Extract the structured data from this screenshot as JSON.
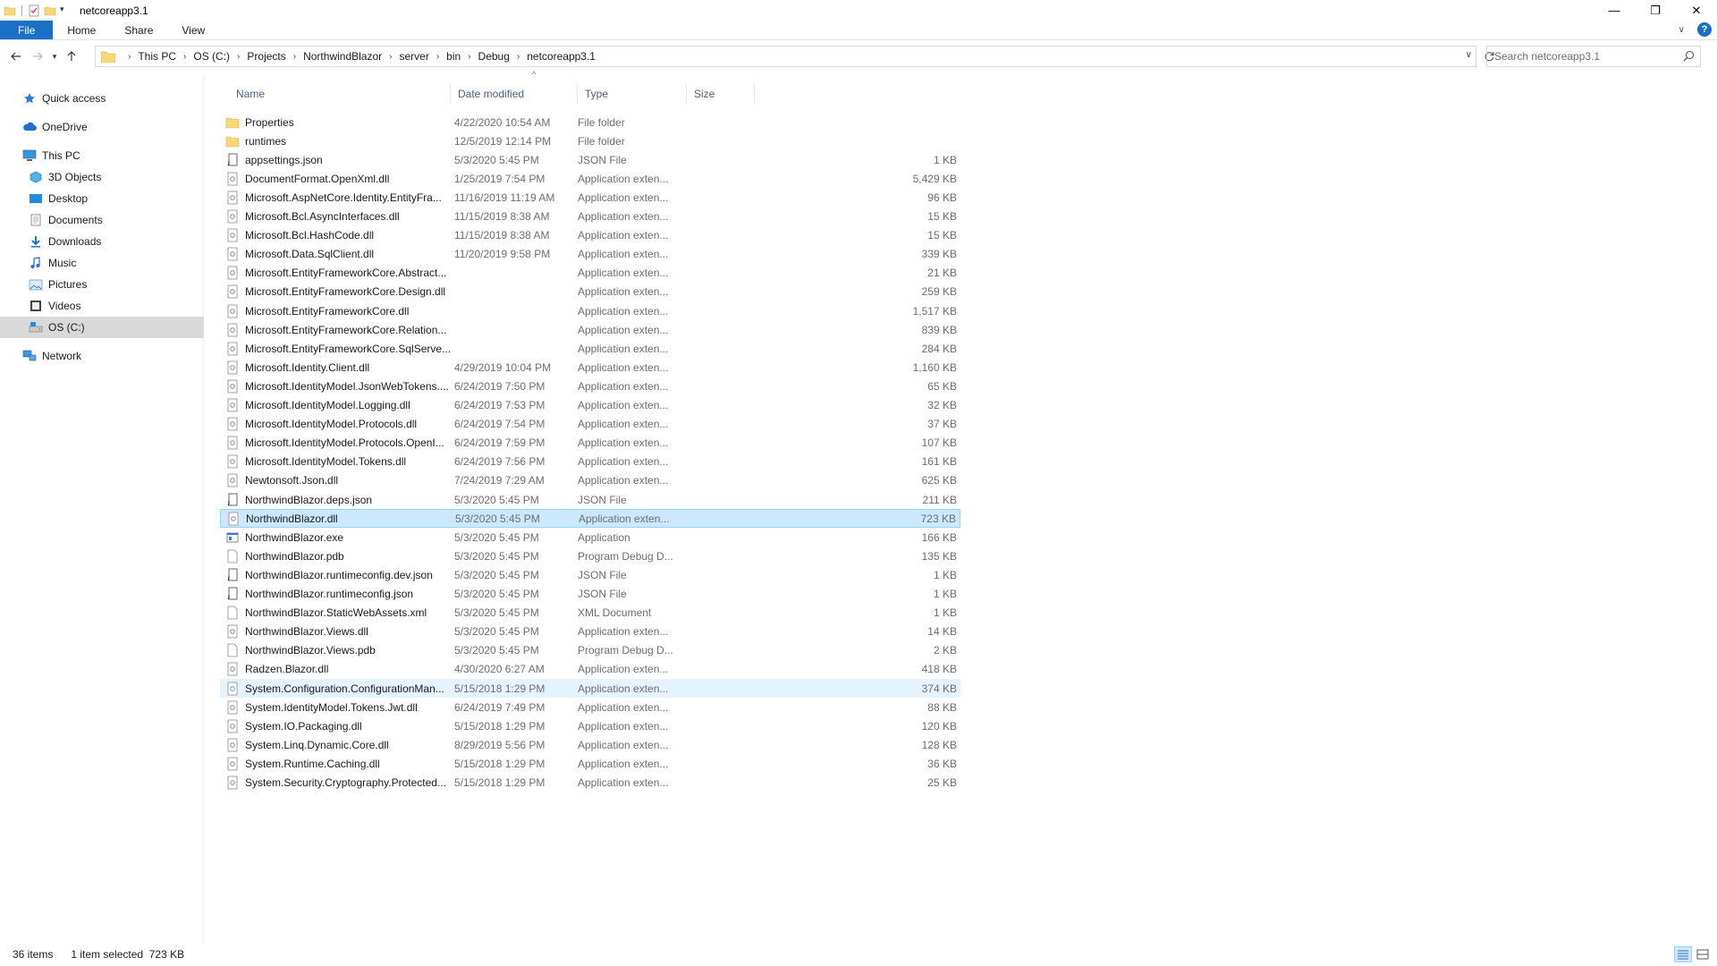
{
  "window": {
    "title": "netcoreapp3.1",
    "controls": {
      "minimize": "—",
      "restore": "❐",
      "close": "✕"
    }
  },
  "ribbon": {
    "tabs": [
      {
        "label": "File"
      },
      {
        "label": "Home"
      },
      {
        "label": "Share"
      },
      {
        "label": "View"
      }
    ]
  },
  "address": {
    "crumbs": [
      "This PC",
      "OS (C:)",
      "Projects",
      "NorthwindBlazor",
      "server",
      "bin",
      "Debug",
      "netcoreapp3.1"
    ]
  },
  "search": {
    "placeholder": "Search netcoreapp3.1"
  },
  "nav": {
    "items": [
      {
        "label": "Quick access",
        "icon": "star-icon"
      },
      {
        "label": "OneDrive",
        "icon": "cloud-icon"
      },
      {
        "label": "This PC",
        "icon": "pc-icon"
      },
      {
        "label": "3D Objects",
        "icon": "cube-icon"
      },
      {
        "label": "Desktop",
        "icon": "desktop-icon"
      },
      {
        "label": "Documents",
        "icon": "documents-icon"
      },
      {
        "label": "Downloads",
        "icon": "download-icon"
      },
      {
        "label": "Music",
        "icon": "music-icon"
      },
      {
        "label": "Pictures",
        "icon": "pictures-icon"
      },
      {
        "label": "Videos",
        "icon": "videos-icon"
      },
      {
        "label": "OS (C:)",
        "icon": "drive-icon"
      },
      {
        "label": "Network",
        "icon": "network-icon"
      }
    ]
  },
  "columns": {
    "name": "Name",
    "date": "Date modified",
    "type": "Type",
    "size": "Size"
  },
  "files": [
    {
      "name": "Properties",
      "date": "4/22/2020 10:54 AM",
      "type": "File folder",
      "size": "",
      "kind": "folder"
    },
    {
      "name": "runtimes",
      "date": "12/5/2019 12:14 PM",
      "type": "File folder",
      "size": "",
      "kind": "folder"
    },
    {
      "name": "appsettings.json",
      "date": "5/3/2020 5:45 PM",
      "type": "JSON File",
      "size": "1 KB",
      "kind": "json"
    },
    {
      "name": "DocumentFormat.OpenXml.dll",
      "date": "1/25/2019 7:54 PM",
      "type": "Application exten...",
      "size": "5,429 KB",
      "kind": "dll"
    },
    {
      "name": "Microsoft.AspNetCore.Identity.EntityFra...",
      "date": "11/16/2019 11:19 AM",
      "type": "Application exten...",
      "size": "96 KB",
      "kind": "dll"
    },
    {
      "name": "Microsoft.Bcl.AsyncInterfaces.dll",
      "date": "11/15/2019 8:38 AM",
      "type": "Application exten...",
      "size": "15 KB",
      "kind": "dll"
    },
    {
      "name": "Microsoft.Bcl.HashCode.dll",
      "date": "11/15/2019 8:38 AM",
      "type": "Application exten...",
      "size": "15 KB",
      "kind": "dll"
    },
    {
      "name": "Microsoft.Data.SqlClient.dll",
      "date": "11/20/2019 9:58 PM",
      "type": "Application exten...",
      "size": "339 KB",
      "kind": "dll"
    },
    {
      "name": "Microsoft.EntityFrameworkCore.Abstract...",
      "date": "",
      "type": "Application exten...",
      "size": "21 KB",
      "kind": "dll"
    },
    {
      "name": "Microsoft.EntityFrameworkCore.Design.dll",
      "date": "",
      "type": "Application exten...",
      "size": "259 KB",
      "kind": "dll"
    },
    {
      "name": "Microsoft.EntityFrameworkCore.dll",
      "date": "",
      "type": "Application exten...",
      "size": "1,517 KB",
      "kind": "dll"
    },
    {
      "name": "Microsoft.EntityFrameworkCore.Relation...",
      "date": "",
      "type": "Application exten...",
      "size": "839 KB",
      "kind": "dll"
    },
    {
      "name": "Microsoft.EntityFrameworkCore.SqlServe...",
      "date": "",
      "type": "Application exten...",
      "size": "284 KB",
      "kind": "dll"
    },
    {
      "name": "Microsoft.Identity.Client.dll",
      "date": "4/29/2019 10:04 PM",
      "type": "Application exten...",
      "size": "1,160 KB",
      "kind": "dll"
    },
    {
      "name": "Microsoft.IdentityModel.JsonWebTokens....",
      "date": "6/24/2019 7:50 PM",
      "type": "Application exten...",
      "size": "65 KB",
      "kind": "dll"
    },
    {
      "name": "Microsoft.IdentityModel.Logging.dll",
      "date": "6/24/2019 7:53 PM",
      "type": "Application exten...",
      "size": "32 KB",
      "kind": "dll"
    },
    {
      "name": "Microsoft.IdentityModel.Protocols.dll",
      "date": "6/24/2019 7:54 PM",
      "type": "Application exten...",
      "size": "37 KB",
      "kind": "dll"
    },
    {
      "name": "Microsoft.IdentityModel.Protocols.OpenI...",
      "date": "6/24/2019 7:59 PM",
      "type": "Application exten...",
      "size": "107 KB",
      "kind": "dll"
    },
    {
      "name": "Microsoft.IdentityModel.Tokens.dll",
      "date": "6/24/2019 7:56 PM",
      "type": "Application exten...",
      "size": "161 KB",
      "kind": "dll"
    },
    {
      "name": "Newtonsoft.Json.dll",
      "date": "7/24/2019 7:29 AM",
      "type": "Application exten...",
      "size": "625 KB",
      "kind": "dll"
    },
    {
      "name": "NorthwindBlazor.deps.json",
      "date": "5/3/2020 5:45 PM",
      "type": "JSON File",
      "size": "211 KB",
      "kind": "json"
    },
    {
      "name": "NorthwindBlazor.dll",
      "date": "5/3/2020 5:45 PM",
      "type": "Application exten...",
      "size": "723 KB",
      "kind": "dll",
      "state": "selected"
    },
    {
      "name": "NorthwindBlazor.exe",
      "date": "5/3/2020 5:45 PM",
      "type": "Application",
      "size": "166 KB",
      "kind": "exe"
    },
    {
      "name": "NorthwindBlazor.pdb",
      "date": "5/3/2020 5:45 PM",
      "type": "Program Debug D...",
      "size": "135 KB",
      "kind": "blank"
    },
    {
      "name": "NorthwindBlazor.runtimeconfig.dev.json",
      "date": "5/3/2020 5:45 PM",
      "type": "JSON File",
      "size": "1 KB",
      "kind": "json"
    },
    {
      "name": "NorthwindBlazor.runtimeconfig.json",
      "date": "5/3/2020 5:45 PM",
      "type": "JSON File",
      "size": "1 KB",
      "kind": "json"
    },
    {
      "name": "NorthwindBlazor.StaticWebAssets.xml",
      "date": "5/3/2020 5:45 PM",
      "type": "XML Document",
      "size": "1 KB",
      "kind": "blank"
    },
    {
      "name": "NorthwindBlazor.Views.dll",
      "date": "5/3/2020 5:45 PM",
      "type": "Application exten...",
      "size": "14 KB",
      "kind": "dll"
    },
    {
      "name": "NorthwindBlazor.Views.pdb",
      "date": "5/3/2020 5:45 PM",
      "type": "Program Debug D...",
      "size": "2 KB",
      "kind": "blank"
    },
    {
      "name": "Radzen.Blazor.dll",
      "date": "4/30/2020 6:27 AM",
      "type": "Application exten...",
      "size": "418 KB",
      "kind": "dll"
    },
    {
      "name": "System.Configuration.ConfigurationMan...",
      "date": "5/15/2018 1:29 PM",
      "type": "Application exten...",
      "size": "374 KB",
      "kind": "dll",
      "state": "hover"
    },
    {
      "name": "System.IdentityModel.Tokens.Jwt.dll",
      "date": "6/24/2019 7:49 PM",
      "type": "Application exten...",
      "size": "88 KB",
      "kind": "dll"
    },
    {
      "name": "System.IO.Packaging.dll",
      "date": "5/15/2018 1:29 PM",
      "type": "Application exten...",
      "size": "120 KB",
      "kind": "dll"
    },
    {
      "name": "System.Linq.Dynamic.Core.dll",
      "date": "8/29/2019 5:56 PM",
      "type": "Application exten...",
      "size": "128 KB",
      "kind": "dll"
    },
    {
      "name": "System.Runtime.Caching.dll",
      "date": "5/15/2018 1:29 PM",
      "type": "Application exten...",
      "size": "36 KB",
      "kind": "dll"
    },
    {
      "name": "System.Security.Cryptography.Protected...",
      "date": "5/15/2018 1:29 PM",
      "type": "Application exten...",
      "size": "25 KB",
      "kind": "dll"
    }
  ],
  "status": {
    "items": "36 items",
    "selection": "1 item selected  723 KB"
  },
  "colors": {
    "accent": "#1a6fc7",
    "selected_bg": "#cce8ff",
    "hover_bg": "#e5f3ff",
    "folder": "#f8d775"
  }
}
